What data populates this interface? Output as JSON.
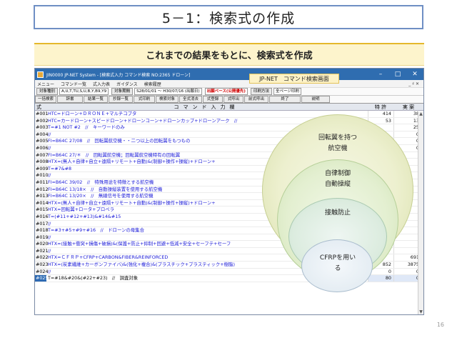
{
  "slide": {
    "title": "5－1：検索式の作成",
    "banner": "これまでの結果をもとに、検索式を作成",
    "page_number": "16"
  },
  "window": {
    "title": "JIN0000 JP-NET System - [検索式入力 コマンド検索 NO:2365 ドローン]",
    "controls": {
      "minimize": "–",
      "maximize": "□",
      "close": "✕"
    },
    "callout": "JP-NET　コマンド検索画面"
  },
  "menu": {
    "items": [
      "メニュー",
      "コマンド一覧",
      "式入力表",
      "ガイダンス",
      "検索履歴"
    ],
    "right": "_ ♯ ✕"
  },
  "toolbar": {
    "type_label": "対象種別",
    "type_value": "A,U,T,TU,S,U,B,Y,B9,Y9",
    "period_label": "対象期間",
    "period_value": "S28/01/01 〜 H30/07/16 (出願日)",
    "base_label": "出願ベース(公開優先)",
    "print_label": "印刷方法",
    "print_value": "全ページ印刷"
  },
  "buttons": [
    "一括検索",
    "辞書",
    "結果一覧",
    "抄録一覧",
    "式印刷",
    "検索対象",
    "全式消去",
    "式登録",
    "式呼出",
    "前式呼出",
    "終了",
    "説明"
  ],
  "grid": {
    "col_no": "式NO.",
    "col_cmd": "コマンド入力欄",
    "col_pat": "特 許",
    "col_res": "実 案",
    "rows": [
      {
        "no": "#001",
        "cmd": "HTC=ドローン+ＤＲＯＮＥ+マルチコプタ",
        "pat": "414",
        "res": "38"
      },
      {
        "no": "#002",
        "cmd": "HTC=カードローン+スピードローン+ドローンコーン+ドローンカップ+ドローンアーク　//",
        "pat": "53",
        "res": "13"
      },
      {
        "no": "#003",
        "cmd": "T=#1 NOT #2　//　キーワードのみ",
        "pat": "",
        "res": "25"
      },
      {
        "no": "#004",
        "cmd": "//",
        "pat": "",
        "res": "0"
      },
      {
        "no": "#005",
        "cmd": "FI=B64C 27/08　//　回転翼航空機・・二つ以上の回転翼をもつもの",
        "pat": "",
        "res": "0"
      },
      {
        "no": "#006",
        "cmd": "//",
        "pat": "",
        "res": "0"
      },
      {
        "no": "#007",
        "cmd": "FI=B64C 27/＊　//　回転翼航空機；回転翼航空機特有の回転翼",
        "pat": "",
        "res": ""
      },
      {
        "no": "#008",
        "cmd": "HTX=(無人+自律+自立+遠隔+リモート+自動)&(制御+操作+操縦)+ドローン+",
        "pat": "",
        "res": ""
      },
      {
        "no": "#009",
        "cmd": "T=#7&#8",
        "pat": "",
        "res": ""
      },
      {
        "no": "#010",
        "cmd": "//",
        "pat": "",
        "res": ""
      },
      {
        "no": "#011",
        "cmd": "FI=B64C 39/02　//　特殊用途を特徴とする航空機",
        "pat": "",
        "res": ""
      },
      {
        "no": "#012",
        "cmd": "FI=B64C 13/18×　//　自動操縦装置を使用する航空機",
        "pat": "",
        "res": ""
      },
      {
        "no": "#013",
        "cmd": "FI=B64C 13/20×　//　無線信号を使用する航空機",
        "pat": "",
        "res": ""
      },
      {
        "no": "#014",
        "cmd": "HTX=(無人+自律+自立+遠隔+リモート+自動)&(制御+操作+操縦)+ドローン+",
        "pat": "",
        "res": ""
      },
      {
        "no": "#015",
        "cmd": "HTX=回転翼+ロータ+プロペラ",
        "pat": "",
        "res": ""
      },
      {
        "no": "#016",
        "cmd": "T=(#11+#12+#13)&#14&#15",
        "pat": "",
        "res": ""
      },
      {
        "no": "#017",
        "cmd": "//",
        "pat": "",
        "res": ""
      },
      {
        "no": "#018",
        "cmd": "T=#3+#5+#9+#16　//　ドローンの母集合",
        "pat": "",
        "res": ""
      },
      {
        "no": "#019",
        "cmd": "//",
        "pat": "",
        "res": ""
      },
      {
        "no": "#020",
        "cmd": "HTX=(接触+衝突+損傷+破損)&(保護+防止+抑制+回避+低減+安全+セーフテ+セーフ",
        "pat": "",
        "res": ""
      },
      {
        "no": "#021",
        "cmd": "//",
        "pat": "",
        "res": ""
      },
      {
        "no": "#022",
        "cmd": "HTX=ＣＦＲＰ+CFRP+CARBON&FIBER&REINFORCED",
        "pat": "",
        "res": "691"
      },
      {
        "no": "#023",
        "cmd": "HTX=(炭素繊維+カーボンファイバ)&(強化+複合)&(プラスチック+プラスティック+樹脂)",
        "pat": "852",
        "res": "3875"
      },
      {
        "no": "#024",
        "cmd": "//",
        "pat": "0",
        "res": "0"
      },
      {
        "no": "#025",
        "cmd": "T=#18&#20&(#22+#23)　//　調査対象",
        "pat": "80",
        "res": "0"
      }
    ]
  },
  "circles": {
    "c1_line1": "回転翼を持つ",
    "c1_line2": "航空機",
    "c2_line1": "自律制御",
    "c2_line2": "自動操縦",
    "c3": "接触防止",
    "c4_line1": "CFRPを用い",
    "c4_line2": "る"
  },
  "colors": {
    "title_border": "#6f8fc4",
    "banner_bg": "#fdf4cc",
    "window_title_bg": "#2f6db0",
    "command_text": "#1a1ad8",
    "red_label": "#d10000"
  }
}
